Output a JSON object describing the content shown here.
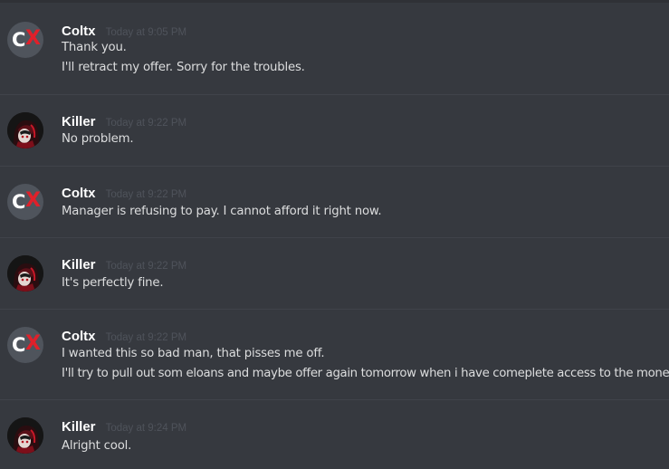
{
  "messages": [
    {
      "author": "Coltx",
      "avatar": "coltx-avatar",
      "time": "Today at 9:05 PM",
      "lines": [
        "Thank you.",
        "I'll retract my offer. Sorry for the troubles."
      ]
    },
    {
      "author": "Killer",
      "avatar": "killer-avatar",
      "time": "Today at 9:22 PM",
      "lines": [
        "No problem."
      ]
    },
    {
      "author": "Coltx",
      "avatar": "coltx-avatar",
      "time": "Today at 9:22 PM",
      "lines": [
        "Manager is refusing to pay. I cannot afford it right now."
      ]
    },
    {
      "author": "Killer",
      "avatar": "killer-avatar",
      "time": "Today at 9:22 PM",
      "lines": [
        "It's perfectly fine."
      ]
    },
    {
      "author": "Coltx",
      "avatar": "coltx-avatar",
      "time": "Today at 9:22 PM",
      "lines": [
        "I wanted this so bad man, that pisses me off.",
        "I'll try to pull out som eloans and maybe offer again tomorrow when i have comeplete access to the money."
      ]
    },
    {
      "author": "Killer",
      "avatar": "killer-avatar",
      "time": "Today at 9:24 PM",
      "lines": [
        "Alright cool."
      ]
    }
  ],
  "avatar_text": {
    "coltx_c": "C",
    "coltx_x": "X"
  },
  "colors": {
    "background": "#36393f",
    "username": "#ffffff",
    "timestamp": "#4f535b",
    "message_text": "#dcddde",
    "coltx_x_accent": "#e0202a"
  }
}
